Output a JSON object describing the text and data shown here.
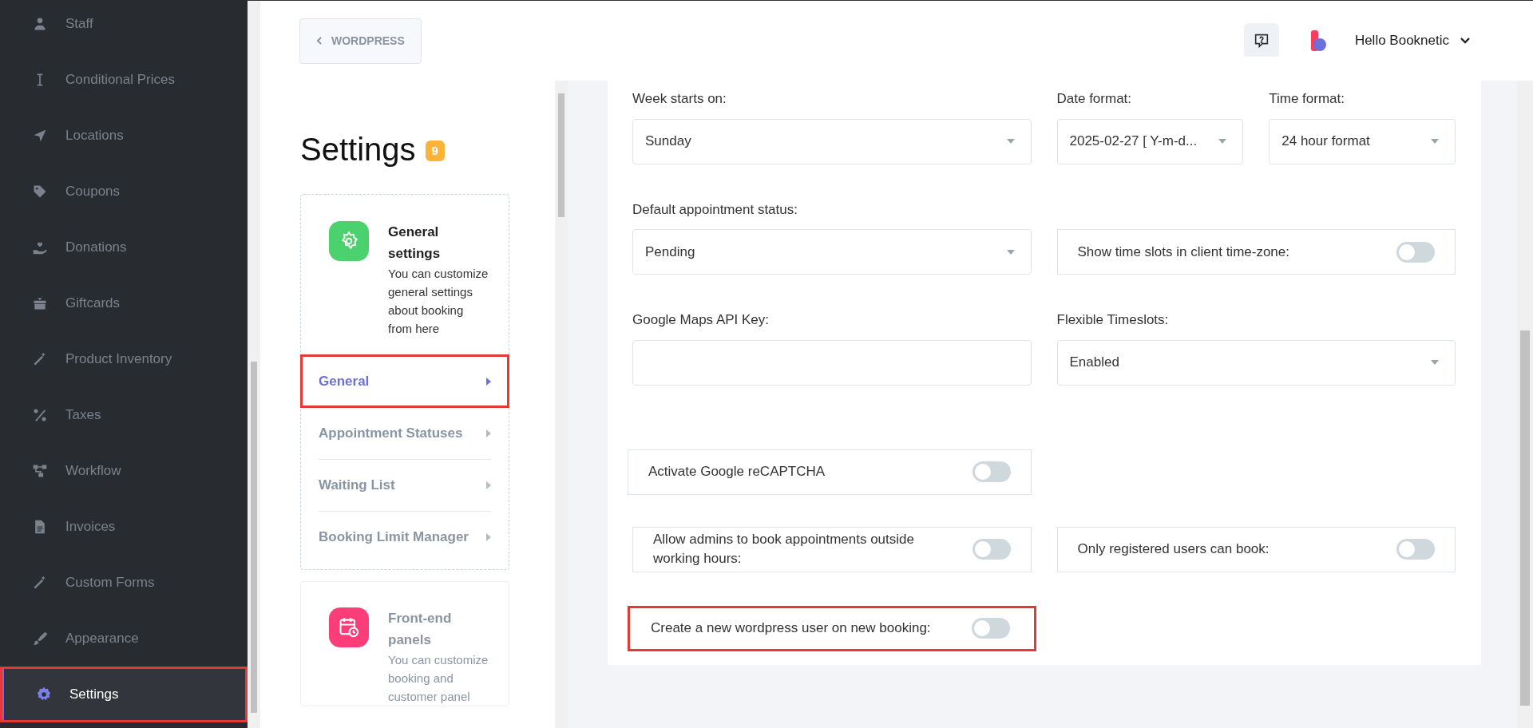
{
  "sidebar": {
    "items": [
      {
        "label": "Staff",
        "selected": false,
        "highlighted": false
      },
      {
        "label": "Conditional Prices",
        "selected": false,
        "highlighted": false
      },
      {
        "label": "Locations",
        "selected": false,
        "highlighted": false
      },
      {
        "label": "Coupons",
        "selected": false,
        "highlighted": false
      },
      {
        "label": "Donations",
        "selected": false,
        "highlighted": false
      },
      {
        "label": "Giftcards",
        "selected": false,
        "highlighted": false
      },
      {
        "label": "Product Inventory",
        "selected": false,
        "highlighted": false
      },
      {
        "label": "Taxes",
        "selected": false,
        "highlighted": false
      },
      {
        "label": "Workflow",
        "selected": false,
        "highlighted": false
      },
      {
        "label": "Invoices",
        "selected": false,
        "highlighted": false
      },
      {
        "label": "Custom Forms",
        "selected": false,
        "highlighted": false
      },
      {
        "label": "Appearance",
        "selected": false,
        "highlighted": false
      },
      {
        "label": "Settings",
        "selected": true,
        "highlighted": true
      }
    ]
  },
  "header": {
    "back_button": "WORDPRESS",
    "user": "Hello Booknetic"
  },
  "settings": {
    "title": "Settings",
    "badge": "9",
    "general_card": {
      "title": "General settings",
      "description": "You can customize general settings about booking from here"
    },
    "menu": [
      {
        "label": "General",
        "selected": true,
        "highlighted": true
      },
      {
        "label": "Appointment Statuses",
        "selected": false,
        "highlighted": false
      },
      {
        "label": "Waiting List",
        "selected": false,
        "highlighted": false
      },
      {
        "label": "Booking Limit Manager",
        "selected": false,
        "highlighted": false
      }
    ],
    "frontend_card": {
      "title": "Front-end panels",
      "description": "You can customize booking and customer panel"
    }
  },
  "form": {
    "rows": [
      [
        {
          "kind": "select",
          "label": "Week starts on:",
          "value": "Sunday"
        },
        {
          "kind": "select",
          "label": "Date format:",
          "value": "2025-02-27 [ Y-m-d..."
        },
        {
          "kind": "select",
          "label": "Time format:",
          "value": "24 hour format"
        }
      ],
      [
        {
          "kind": "select",
          "label": "Default appointment status:",
          "value": "Pending"
        },
        {
          "kind": "toggle",
          "label": "Show time slots in client time-zone:",
          "on": false,
          "highlighted": false
        }
      ],
      [
        {
          "kind": "input",
          "label": "Google Maps API Key:"
        },
        {
          "kind": "select",
          "label": "Flexible Timeslots:",
          "value": "Enabled"
        }
      ],
      [
        {
          "kind": "toggle",
          "label": "Activate Google reCAPTCHA",
          "on": false,
          "highlighted": false
        }
      ],
      [
        {
          "kind": "toggle",
          "label": "Allow admins to book appointments outside working hours:",
          "on": false,
          "highlighted": false
        },
        {
          "kind": "toggle",
          "label": "Only registered users can book:",
          "on": false,
          "highlighted": false
        }
      ],
      [
        {
          "kind": "toggle",
          "label": "Create a new wordpress user on new booking:",
          "on": false,
          "highlighted": true
        }
      ]
    ]
  }
}
